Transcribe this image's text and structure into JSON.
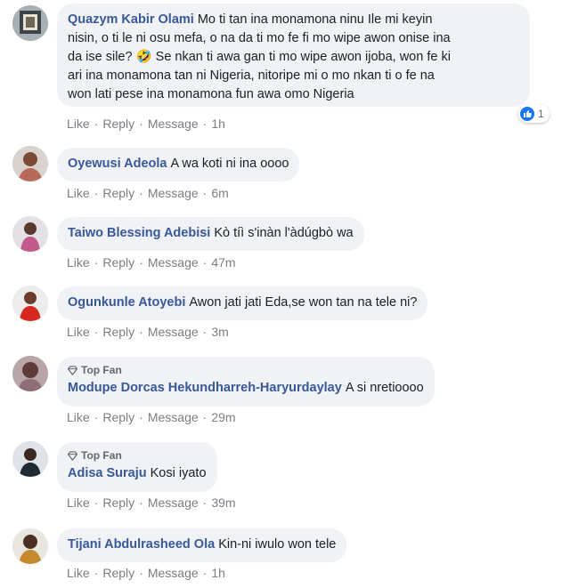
{
  "labels": {
    "like": "Like",
    "reply": "Reply",
    "message": "Message",
    "separator": "·",
    "top_fan": "Top Fan"
  },
  "comments": [
    {
      "name": "Quazym Kabir Olami",
      "text_line1": "Mo ti tan ina monamona ninu Ile mi keyin",
      "text_line2": "nisin, o ti le ni osu mefa, o na da ti mo fe fi mo wipe awon onise ina",
      "text_line3": "da ise sile? 🤣 Se nkan ti awa gan ti mo wipe awon ijoba, won fe ki",
      "text_line4": "ari ina monamona tan ni Nigeria, nitoripe mi o mo nkan ti o fe na",
      "text_line5": "won lati pese ina monamona fun awa omo Nigeria",
      "time": "1h",
      "reaction_count": "1"
    },
    {
      "name": "Oyewusi Adeola",
      "text": "A wa koti ni ina oooo",
      "time": "6m"
    },
    {
      "name": "Taiwo Blessing Adebisi",
      "text": "Kò tíì s'inàn l'àdúgbò wa",
      "time": "47m"
    },
    {
      "name": "Ogunkunle Atoyebi",
      "text": "Awon jati jati Eda,se won tan na tele ni?",
      "time": "3m"
    },
    {
      "name": "Modupe Dorcas Hekundharreh-Haryurdaylay",
      "text": "A si nretioooo",
      "time": "29m"
    },
    {
      "name": "Adisa Suraju",
      "text": "Kosi iyato",
      "time": "39m"
    },
    {
      "name": "Tijani Abdulrasheed Ola",
      "text": "Kin-ni iwulo won tele",
      "time": "1h"
    }
  ],
  "colors": {
    "name": "#385898",
    "bubble": "#f0f2f5",
    "meta": "#7a7d82",
    "like_blue": "#1877f2"
  }
}
